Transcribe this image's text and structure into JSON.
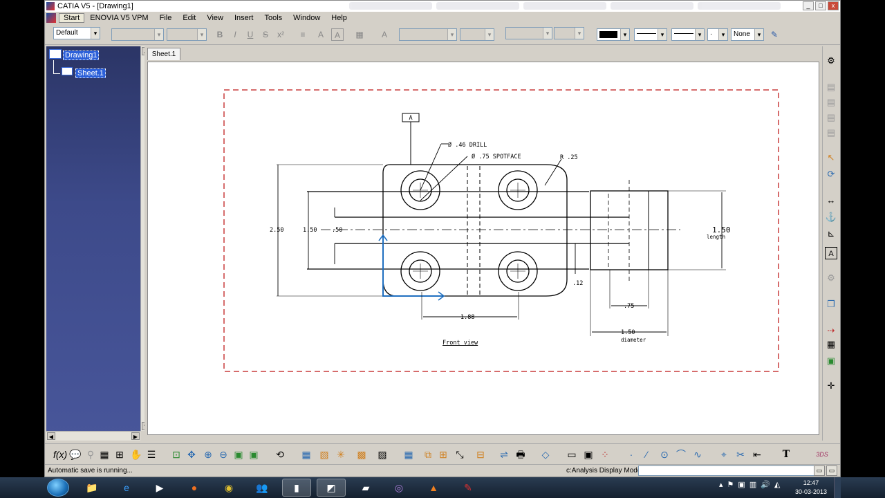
{
  "window": {
    "title": "CATIA V5 - [Drawing1]",
    "ghost_tabs": [
      "",
      "",
      "",
      "",
      "",
      ""
    ],
    "buttons": [
      "_",
      "□",
      "x"
    ]
  },
  "menubar": {
    "items": [
      "Start",
      "ENOVIA V5 VPM",
      "File",
      "Edit",
      "View",
      "Insert",
      "Tools",
      "Window",
      "Help"
    ]
  },
  "toolbar": {
    "style_value": "Default",
    "fill_value": "None",
    "format_buttons": [
      "B",
      "I",
      "U",
      "S",
      "x²",
      "≡",
      "A",
      "A",
      "▦"
    ]
  },
  "tree": {
    "root": "Drawing1",
    "child": "Sheet.1"
  },
  "document": {
    "sheet_tab": "Sheet.1"
  },
  "drawing": {
    "datum_label": "A",
    "callout_drill": "Ø .46  DRILL",
    "callout_spotface": "Ø .75  SPOTFACE",
    "callout_radius": "R .25",
    "dim_250": "2.50",
    "dim_150_left": "1.50",
    "dim_50": ".50",
    "dim_150_right": "1.50",
    "length_label": "length",
    "dim_12": ".12",
    "dim_188": "1.88",
    "dim_75": ".75",
    "dim_150_bottom": "1.50",
    "diameter_label": "diameter",
    "view_title": "Front view"
  },
  "status": {
    "left": "Automatic save is running...",
    "mode": "c:Analysis Display Mode"
  },
  "taskbar": {
    "time": "12:47",
    "date": "30-03-2013"
  },
  "colors": {
    "frame_red": "#c83c3c",
    "axis_blue": "#1f6fc0",
    "tree_bg": "#3d4a8a"
  }
}
